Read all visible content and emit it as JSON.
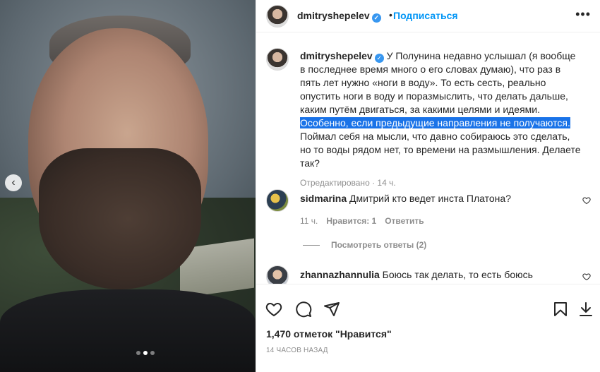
{
  "header": {
    "username": "dmitryshepelev",
    "separator": "•",
    "follow_label": "Подписаться",
    "more_label": "•••"
  },
  "photo": {
    "prev_icon": "chevron-left-icon",
    "prev_label": "‹",
    "carousel_pages": 3,
    "carousel_active_index": 1
  },
  "caption": {
    "username": "dmitryshepelev",
    "text_before": " У Полунина недавно услышал (я вообще в последнее время много о его словах думаю), что раз в пять лет нужно «ноги в воду». То есть сесть, реально опустить ноги в воду и поразмыслить, что делать дальше, каким путём двигаться, за какими целями и идеями. ",
    "text_highlighted": "Особенно, если предыдущие направления не получаются.",
    "text_after": " Поймал себя на мысли, что давно собираюсь это сделать, но то воды рядом нет, то времени на размышления. Делаете так?",
    "meta": "Отредактировано · 14 ч."
  },
  "comments": [
    {
      "username": "sidmarina",
      "text": " Дмитрий кто ведет инста Платона?",
      "age": "11 ч.",
      "likes": "Нравится: 1",
      "reply": "Ответить"
    },
    {
      "username": "zhannazhannulia",
      "text": " Боюсь так делать, то есть боюсь собственных мыслей. Может и лучше, что то воды нет, то"
    }
  ],
  "replies_label": "Посмотреть ответы (2)",
  "footer": {
    "likes_count": "1,470 отметок \"Нравится\"",
    "posted_time": "14 ЧАСОВ НАЗАД"
  },
  "colors": {
    "accent": "#0095f6",
    "verified": "#3897f0",
    "highlight": "#1a73e8",
    "secondary_text": "#8e8e8e"
  }
}
